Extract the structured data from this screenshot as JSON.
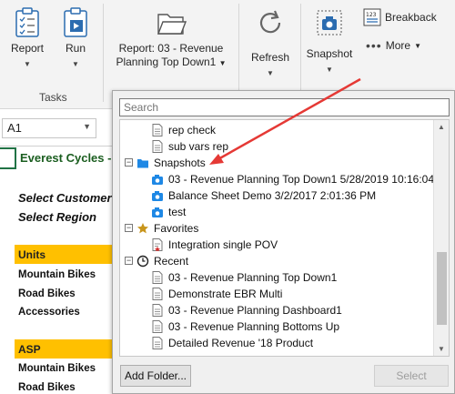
{
  "ribbon": {
    "report_label": "Report",
    "run_label": "Run",
    "report_select_line1": "Report: 03 - Revenue",
    "report_select_line2": "Planning Top Down1",
    "refresh_label": "Refresh",
    "snapshot_label": "Snapshot",
    "breakback_label": "Breakback",
    "more_label": "More",
    "group_tasks": "Tasks"
  },
  "sheet": {
    "namebox": "A1",
    "title": "Everest Cycles -",
    "select_customer": "Select Customer",
    "select_region": "Select Region",
    "units_header": "Units",
    "units_rows": [
      "Mountain Bikes",
      "Road Bikes",
      "Accessories"
    ],
    "asp_header": "ASP",
    "asp_rows": [
      "Mountain Bikes",
      "Road Bikes"
    ]
  },
  "dialog": {
    "search_placeholder": "Search",
    "top_items": [
      "rep check",
      "sub vars rep"
    ],
    "snapshots_label": "Snapshots",
    "snapshots": [
      "03 - Revenue Planning Top Down1 5/28/2019 10:16:04 AM",
      "Balance Sheet Demo 3/2/2017 2:01:36 PM",
      "test"
    ],
    "favorites_label": "Favorites",
    "favorites": [
      "Integration single POV"
    ],
    "recent_label": "Recent",
    "recent": [
      "03 - Revenue Planning Top Down1",
      "Demonstrate EBR Multi",
      "03 - Revenue Planning Dashboard1",
      "03 - Revenue Planning Bottoms Up",
      "Detailed Revenue '18 Product"
    ],
    "add_folder_label": "Add Folder...",
    "select_label": "Select"
  },
  "colors": {
    "units_header_bg": "#ffc000",
    "title_green": "#1b5e20",
    "annotation_arrow": "#e53935",
    "snapshot_icon": "#1e88e5",
    "favorites_star": "#c8951c"
  }
}
